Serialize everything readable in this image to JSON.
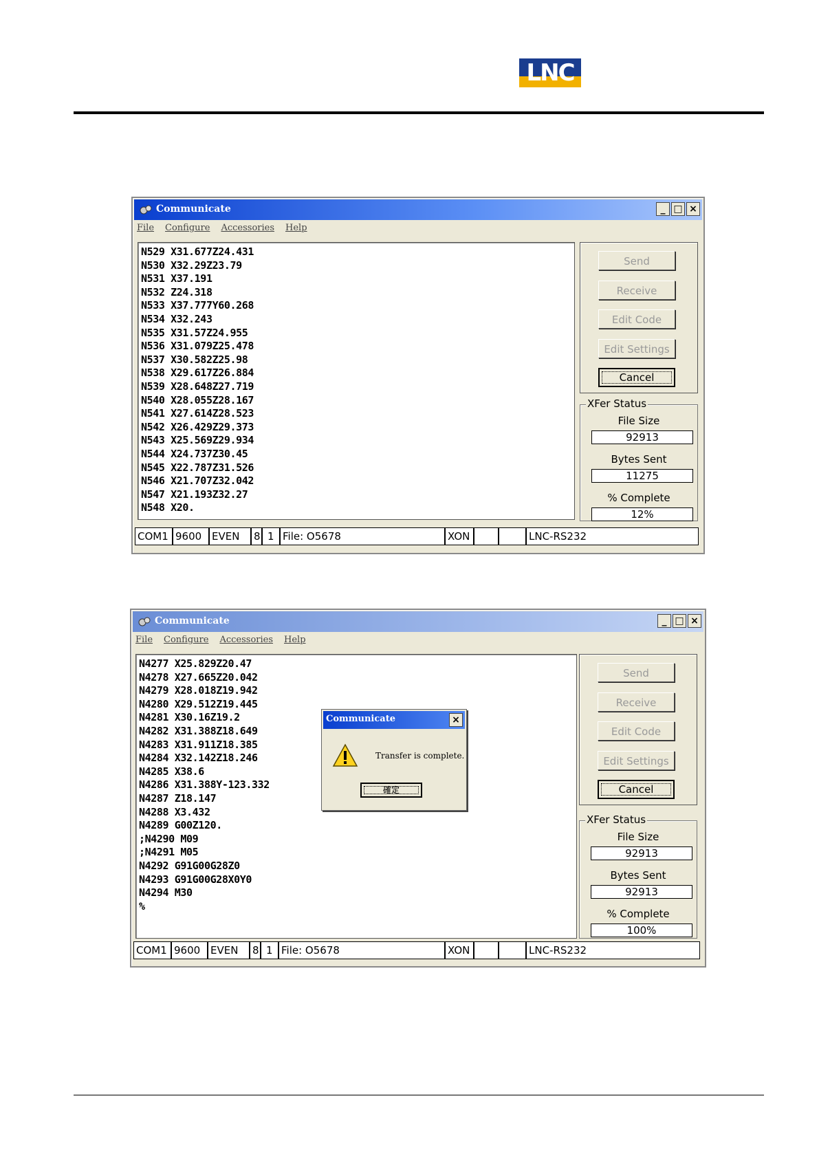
{
  "header": {
    "logo_text": "LNC"
  },
  "window1": {
    "title": "Communicate",
    "menu": [
      "File",
      "Configure",
      "Accessories",
      "Help"
    ],
    "code_lines": [
      "N529 X31.677Z24.431",
      "N530 X32.29Z23.79",
      "N531 X37.191",
      "N532 Z24.318",
      "N533 X37.777Y60.268",
      "N534 X32.243",
      "N535 X31.57Z24.955",
      "N536 X31.079Z25.478",
      "N537 X30.582Z25.98",
      "N538 X29.617Z26.884",
      "N539 X28.648Z27.719",
      "N540 X28.055Z28.167",
      "N541 X27.614Z28.523",
      "N542 X26.429Z29.373",
      "N543 X25.569Z29.934",
      "N544 X24.737Z30.45",
      "N545 X22.787Z31.526",
      "N546 X21.707Z32.042",
      "N547 X21.193Z32.27",
      "N548 X20."
    ],
    "buttons": {
      "send": "Send",
      "receive": "Receive",
      "edit_code": "Edit Code",
      "edit_settings": "Edit Settings",
      "cancel": "Cancel"
    },
    "xfer": {
      "legend": "XFer Status",
      "file_size_label": "File Size",
      "file_size": "92913",
      "bytes_sent_label": "Bytes Sent",
      "bytes_sent": "11275",
      "complete_label": "% Complete",
      "complete": "12%"
    },
    "status": {
      "port": "COM1",
      "baud": "9600",
      "parity": "EVEN",
      "data_bits": "8",
      "stop_bits": "1",
      "file": "File: O5678",
      "flow": "XON",
      "empty1": "",
      "empty2": "",
      "protocol": "LNC-RS232"
    }
  },
  "window2": {
    "title": "Communicate",
    "menu": [
      "File",
      "Configure",
      "Accessories",
      "Help"
    ],
    "code_lines": [
      "N4277 X25.829Z20.47",
      "N4278 X27.665Z20.042",
      "N4279 X28.018Z19.942",
      "N4280 X29.512Z19.445",
      "N4281 X30.16Z19.2",
      "N4282 X31.388Z18.649",
      "N4283 X31.911Z18.385",
      "N4284 X32.142Z18.246",
      "N4285 X38.6",
      "N4286 X31.388Y-123.332",
      "N4287 Z18.147",
      "N4288 X3.432",
      "N4289 G00Z120.",
      ";N4290 M09",
      ";N4291 M05",
      "N4292 G91G00G28Z0",
      "N4293 G91G00G28X0Y0",
      "N4294 M30",
      "%"
    ],
    "buttons": {
      "send": "Send",
      "receive": "Receive",
      "edit_code": "Edit Code",
      "edit_settings": "Edit Settings",
      "cancel": "Cancel"
    },
    "xfer": {
      "legend": "XFer Status",
      "file_size_label": "File Size",
      "file_size": "92913",
      "bytes_sent_label": "Bytes Sent",
      "bytes_sent": "92913",
      "complete_label": "% Complete",
      "complete": "100%"
    },
    "status": {
      "port": "COM1",
      "baud": "9600",
      "parity": "EVEN",
      "data_bits": "8",
      "stop_bits": "1",
      "file": "File: O5678",
      "flow": "XON",
      "empty1": "",
      "empty2": "",
      "protocol": "LNC-RS232"
    },
    "popup": {
      "title": "Communicate",
      "message": "Transfer is complete.",
      "ok": "確定"
    }
  }
}
